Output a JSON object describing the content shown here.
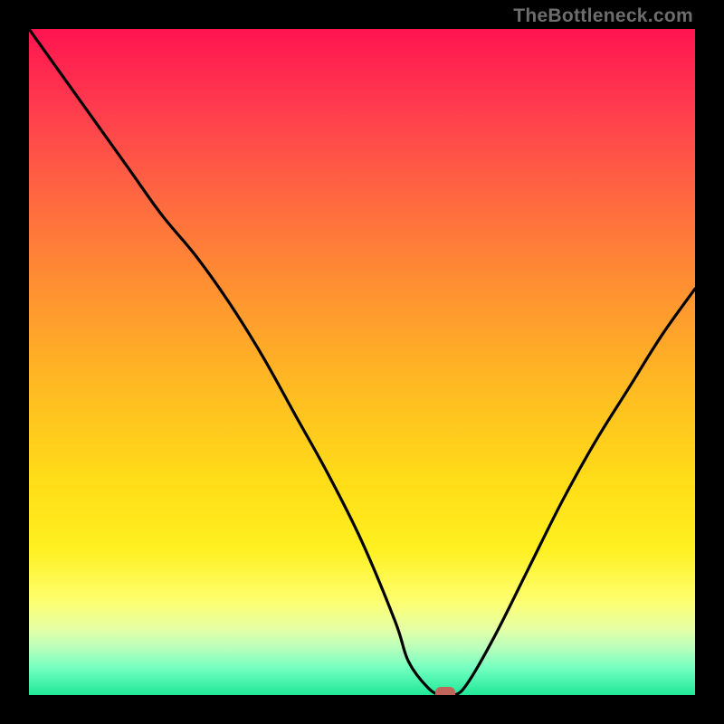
{
  "watermark": "TheBottleneck.com",
  "chart_data": {
    "type": "line",
    "title": "",
    "xlabel": "",
    "ylabel": "",
    "xlim": [
      0,
      100
    ],
    "ylim": [
      0,
      100
    ],
    "x": [
      0,
      5,
      10,
      15,
      20,
      25,
      30,
      35,
      40,
      45,
      50,
      55,
      57,
      60,
      62,
      64,
      66,
      70,
      75,
      80,
      85,
      90,
      95,
      100
    ],
    "values": [
      100,
      93,
      86,
      79,
      72,
      66,
      59,
      51,
      42,
      33,
      23,
      11,
      5,
      1,
      0,
      0,
      2,
      9,
      19,
      29,
      38,
      46,
      54,
      61
    ],
    "marker": {
      "x": 62.5,
      "y": 0,
      "color": "#c1645a"
    },
    "gradient_colors": [
      "#ff1450",
      "#ffdd18",
      "#20e898"
    ]
  }
}
